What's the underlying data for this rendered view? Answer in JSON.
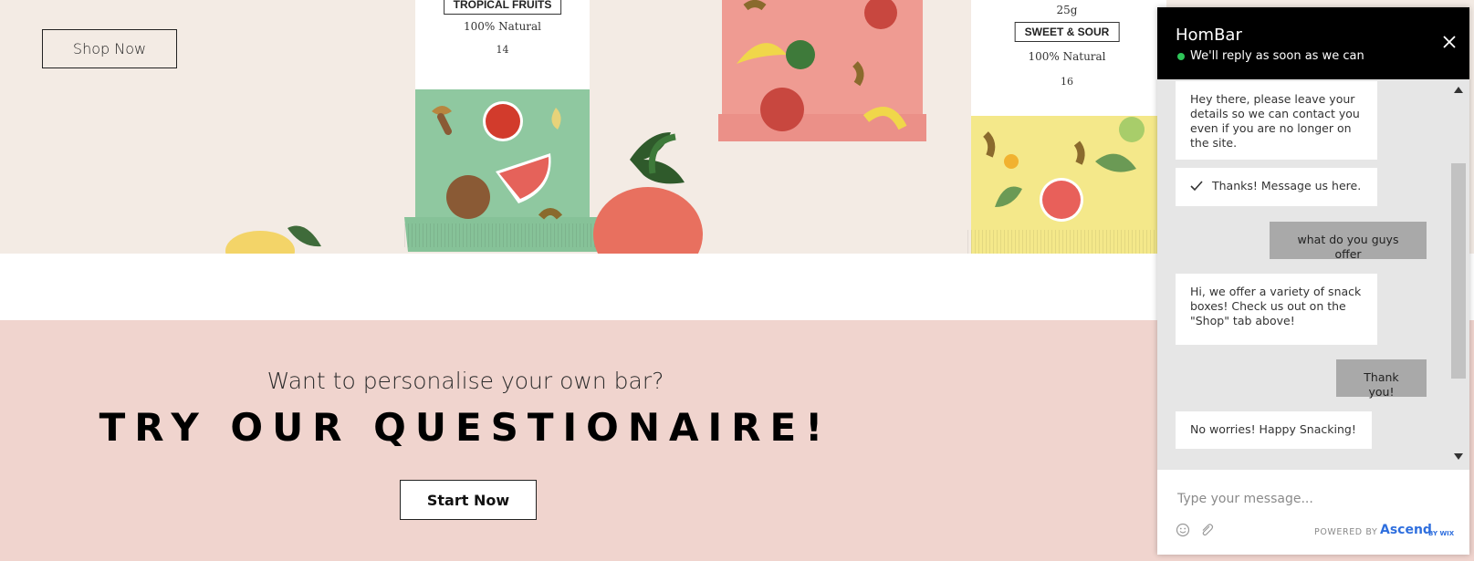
{
  "hero": {
    "shop_button": "Shop Now",
    "packs": [
      {
        "label": "TROPICAL FRUITS",
        "subtitle": "100% Natural",
        "number": "14"
      },
      {
        "label": "",
        "subtitle": "",
        "number": ""
      },
      {
        "weight": "25g",
        "label": "SWEET & SOUR",
        "subtitle": "100% Natural",
        "number": "16"
      }
    ]
  },
  "questionnaire": {
    "subtitle": "Want to personalise your own bar?",
    "title": "TRY OUR QUESTIONAIRE!",
    "button": "Start Now"
  },
  "chat": {
    "title": "HomBar",
    "status": "We'll reply as soon as we can",
    "status_color": "#2ec458",
    "messages": [
      {
        "from": "business",
        "text": "Hey there, please leave your details so we can contact you even if you are no longer on the site."
      },
      {
        "from": "business",
        "text": "Thanks! Message us here.",
        "icon": "check-icon"
      },
      {
        "from": "visitor",
        "text": "what do you guys offer"
      },
      {
        "from": "business",
        "text": "Hi, we offer a variety of snack boxes! Check us out on the \"Shop\" tab above!"
      },
      {
        "from": "visitor",
        "text": "Thank you!"
      },
      {
        "from": "business",
        "text": "No worries! Happy Snacking!"
      }
    ],
    "input_placeholder": "Type your message...",
    "powered_by": "POWERED BY",
    "brand": "Ascend",
    "brand_suffix": "BY WIX",
    "brand_color": "#2f6fde"
  }
}
